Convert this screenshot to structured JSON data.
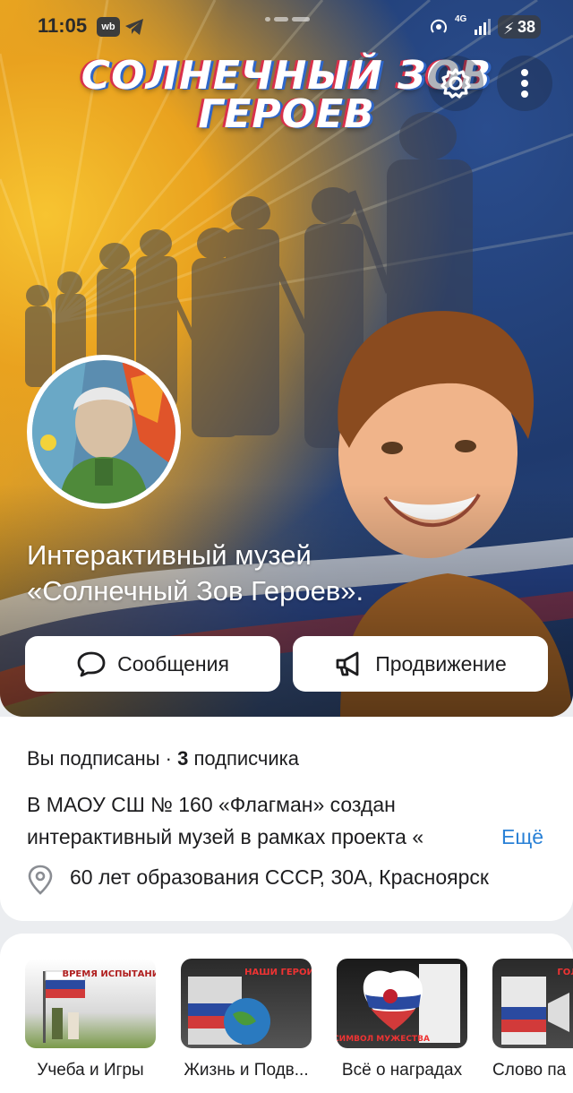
{
  "status_bar": {
    "time": "11:05",
    "app_badge": "wb",
    "network": "4G",
    "battery": "38"
  },
  "cover": {
    "title_line1": "СОЛНЕЧНЫЙ ЗОВ",
    "title_line2": "ГЕРОЕВ"
  },
  "group": {
    "name_line1": "Интерактивный музей",
    "name_line2": "«Солнечный Зов Героев»."
  },
  "actions": {
    "messages_label": "Сообщения",
    "promotion_label": "Продвижение"
  },
  "info": {
    "subscribed_text": "Вы подписаны",
    "separator": " · ",
    "subscribers_count": "3",
    "subscribers_word": "подписчика",
    "description_line1": "В МАОУ СШ № 160 «Флагман» создан",
    "description_line2": "интерактивный музей в рамках проекта «",
    "more_label": "Ещё",
    "address": "60 лет образования СССР, 30А, Красноярск"
  },
  "albums": [
    {
      "label": "Учеба и Игры",
      "badge": "ВРЕМЯ ИСПЫТАНИЙ"
    },
    {
      "label": "Жизнь и Подв...",
      "badge": "НАШИ ГЕРОИ"
    },
    {
      "label": "Всё о наградах",
      "badge": "СИМВОЛ МУЖЕСТВА"
    },
    {
      "label": "Слово па",
      "badge": "ГОЛ"
    }
  ],
  "colors": {
    "accent_link": "#2a81d6",
    "hero_gold": "#e5a824",
    "hero_blue": "#24437c"
  }
}
